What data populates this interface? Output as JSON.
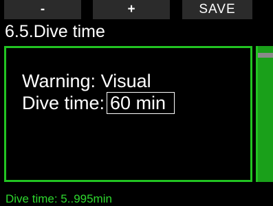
{
  "softkeys": {
    "minus": "-",
    "plus": "+",
    "save": "SAVE"
  },
  "title": "6.5.Dive time",
  "settings": {
    "warning_label": "Warning:",
    "warning_value": "Visual",
    "dive_time_label": "Dive time:",
    "dive_time_value": "60 min"
  },
  "footer": "Dive time: 5..995min",
  "scrollbar": {
    "position_fraction": 0.05
  },
  "colors": {
    "accent": "#22c422",
    "background": "#000000",
    "softkey": "#2b2b2b"
  }
}
